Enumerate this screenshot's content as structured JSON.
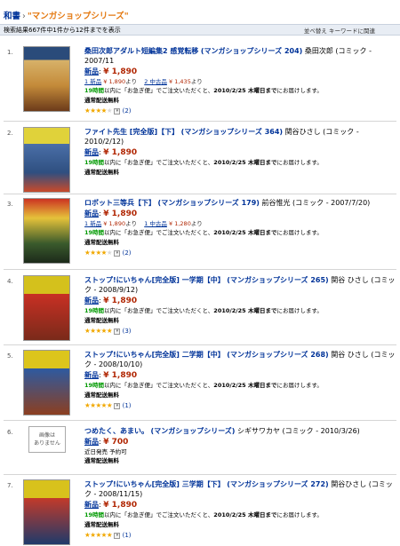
{
  "breadcrumb": {
    "root": "和書",
    "separator": "›",
    "current": "\"マンガショップシリーズ\""
  },
  "result_summary": "検索結果667件中1件から12件までを表示",
  "sort_label": "並べ替え  キーワードに関連",
  "labels": {
    "new": "新品",
    "free_shipping": "通常配送無料",
    "delivery_suffix": "以内に「お急ぎ便」でご注文いただくと、",
    "delivery_tail": "にお届けします。",
    "no_image": "画像は\nありません"
  },
  "items": [
    {
      "num": "1.",
      "title": "桑田次郎アダルト短編集2 感覚転移",
      "series": "(マンガショップシリーズ 204)",
      "meta": "桑田次郎 (コミック - 2007/11",
      "price": "¥ 1,890",
      "used_new_label": "1 新品",
      "used_new_price": "¥ 1,890",
      "used_new_suffix": "より",
      "used_used_label": "2 中古品",
      "used_used_price": "¥ 1,435",
      "used_used_suffix": "より",
      "hours": "19時間",
      "date": "2010/2/25 木曜日まで",
      "stars": 4,
      "reviews": "(2)"
    },
    {
      "num": "2.",
      "title": "ファイト先生 [完全版]【下】",
      "series": "(マンガショップシリーズ 364)",
      "meta": "関谷ひさし (コミック - 2010/2/12)",
      "price": "¥ 1,890",
      "hours": "19時間",
      "date": "2010/2/25 木曜日まで"
    },
    {
      "num": "3.",
      "title": "ロボット三等兵【下】",
      "series": "(マンガショップシリーズ 179)",
      "meta": "前谷惟光 (コミック - 2007/7/20)",
      "price": "¥ 1,890",
      "used_new_label": "1 新品",
      "used_new_price": "¥ 1,890",
      "used_new_suffix": "より",
      "used_used_label": "1 中古品",
      "used_used_price": "¥ 1,280",
      "used_used_suffix": "より",
      "hours": "19時間",
      "date": "2010/2/25 木曜日まで",
      "stars": 3.5,
      "reviews": "(2)"
    },
    {
      "num": "4.",
      "title": "ストップ!にいちゃん[完全版] 一学期【中】",
      "series": "(マンガショップシリーズ 265)",
      "meta": "関谷 ひさし (コミック - 2008/9/12)",
      "price": "¥ 1,890",
      "hours": "19時間",
      "date": "2010/2/25 木曜日まで",
      "stars": 4.5,
      "reviews": "(3)"
    },
    {
      "num": "5.",
      "title": "ストップ!にいちゃん[完全版] 二学期【中】",
      "series": "(マンガショップシリーズ 268)",
      "meta": "関谷 ひさし (コミック - 2008/10/10)",
      "price": "¥ 1,890",
      "hours": "19時間",
      "date": "2010/2/25 木曜日まで",
      "stars": 5,
      "reviews": "(1)"
    },
    {
      "num": "6.",
      "title": "つめたく、あまい。",
      "series": "(マンガショップシリーズ)",
      "meta": "シギサワカヤ (コミック - 2010/3/26)",
      "price": "¥ 700",
      "status": "近日発売  予約可"
    },
    {
      "num": "7.",
      "title": "ストップ!にいちゃん[完全版] 三学期【下】",
      "series": "(マンガショップシリーズ 272)",
      "meta": "関谷ひさし (コミック - 2008/11/15)",
      "price": "¥ 1,890",
      "hours": "19時間",
      "date": "2010/2/25 木曜日まで",
      "stars": 5,
      "reviews": "(1)"
    }
  ]
}
